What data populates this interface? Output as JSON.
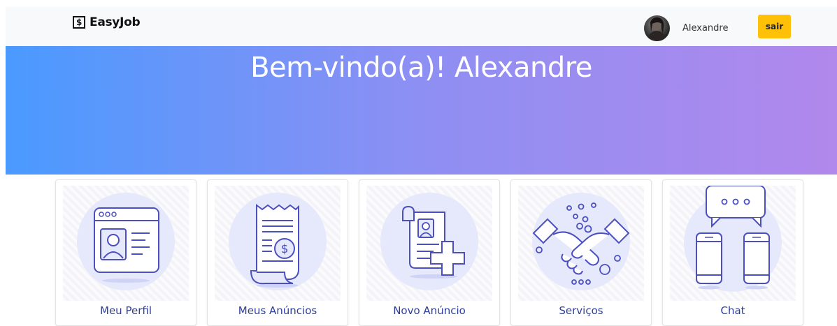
{
  "navbar": {
    "brand_icon": "$",
    "brand": "EasyJob",
    "username": "Alexandre",
    "logout_label": "sair"
  },
  "hero": {
    "title": "Bem-vindo(a)! Alexandre"
  },
  "cards": [
    {
      "label": "Meu Perfil",
      "icon": "profile-window-icon"
    },
    {
      "label": "Meus Anúncios",
      "icon": "receipt-dollar-icon"
    },
    {
      "label": "Novo Anúncio",
      "icon": "new-document-plus-icon"
    },
    {
      "label": "Serviços",
      "icon": "handshake-icon"
    },
    {
      "label": "Chat",
      "icon": "chat-phones-icon"
    }
  ],
  "colors": {
    "navbar_bg": "#f8f9fa",
    "hero_gradient_start": "#4a9aff",
    "hero_gradient_end": "#b188ec",
    "logout_btn": "#ffc107",
    "card_label": "#2c3e9b",
    "illustration_stroke": "#4b4fc0",
    "illustration_fill": "#e6e8fb"
  }
}
